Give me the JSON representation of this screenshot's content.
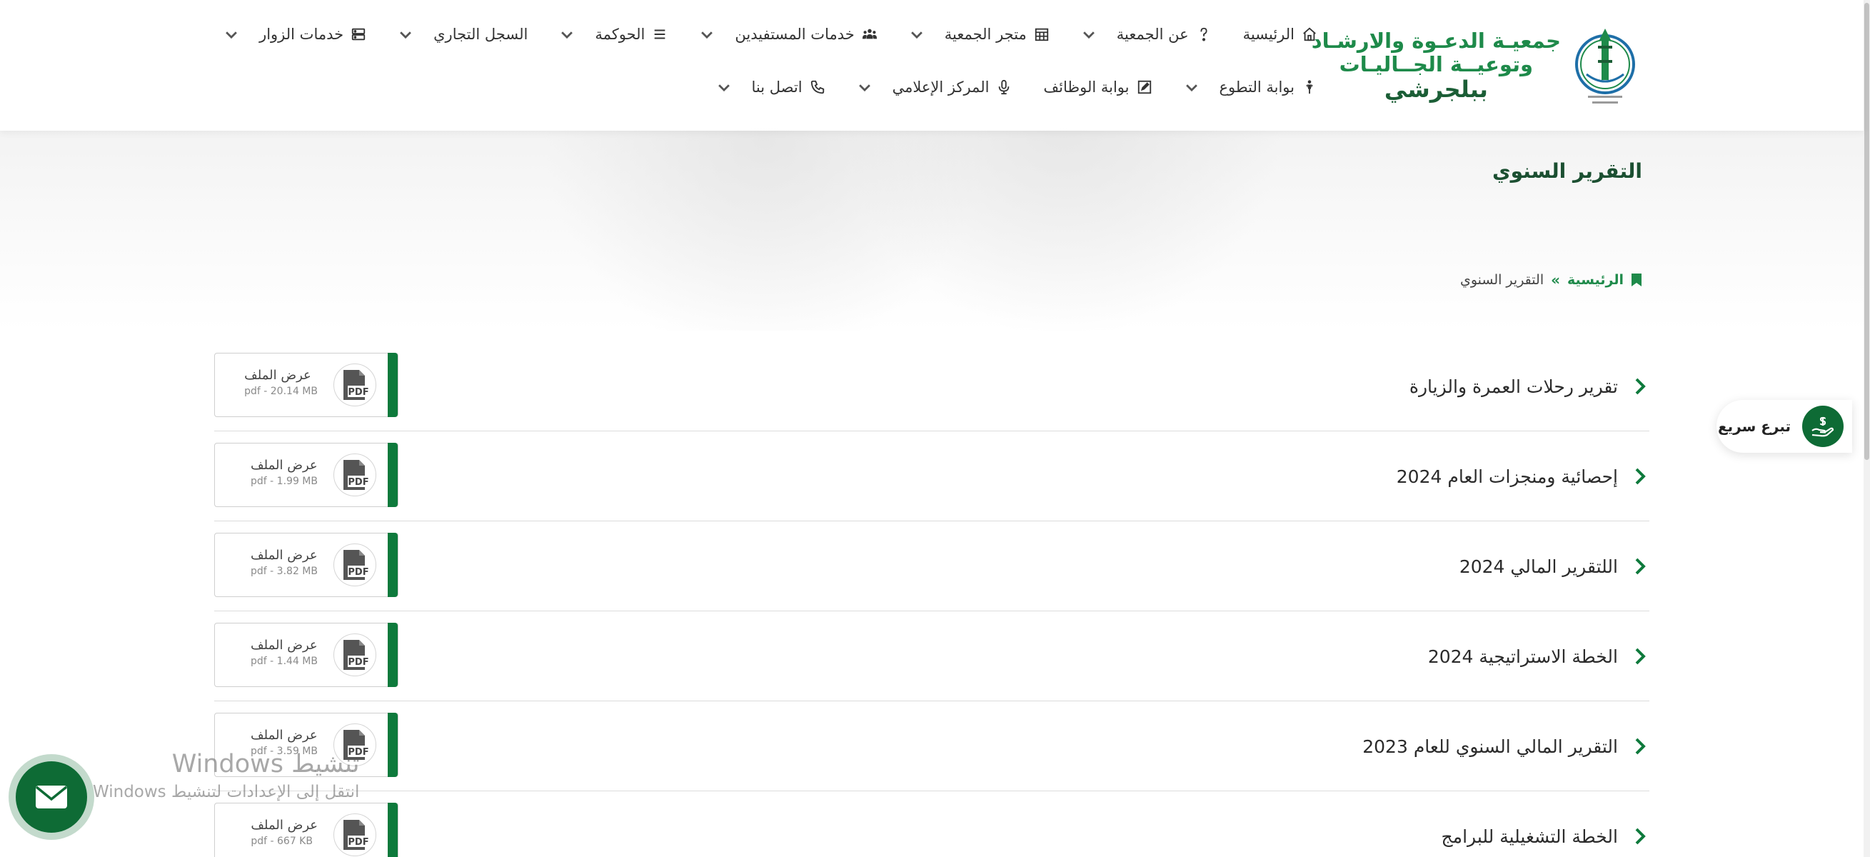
{
  "logo": {
    "line1": "جمعيـة الدعـوة والارشـاد",
    "line2": "وتوعيــة الجــاليـات",
    "line3": "ببلجرشي"
  },
  "nav": {
    "row1": [
      {
        "label": "الرئيسية",
        "icon": "home-icon",
        "dropdown": false
      },
      {
        "label": "عن الجمعية",
        "icon": "question-icon",
        "dropdown": true
      },
      {
        "label": "متجر الجمعية",
        "icon": "calendar-icon",
        "dropdown": true
      },
      {
        "label": "خدمات المستفيدين",
        "icon": "users-icon",
        "dropdown": true
      },
      {
        "label": "الحوكمة",
        "icon": "list-icon",
        "dropdown": true
      },
      {
        "label": "السجل التجاري",
        "icon": "",
        "dropdown": true
      },
      {
        "label": "خدمات الزوار",
        "icon": "server-icon",
        "dropdown": true
      }
    ],
    "row2": [
      {
        "label": "بوابة التطوع",
        "icon": "volunteer-icon",
        "dropdown": true
      },
      {
        "label": "بوابة الوظائف",
        "icon": "edit-icon",
        "dropdown": false
      },
      {
        "label": "المركز الإعلامي",
        "icon": "microphone-icon",
        "dropdown": true
      },
      {
        "label": "اتصل بنا",
        "icon": "phone-icon",
        "dropdown": true
      }
    ]
  },
  "page": {
    "title": "التقرير السنوي",
    "breadcrumb_home": "الرئيسية",
    "breadcrumb_sep": "»",
    "breadcrumb_current": "التقرير السنوي"
  },
  "files": [
    {
      "title": "تقرير رحلات العمرة والزيارة",
      "view_label": "عرض الملف",
      "size": "pdf - 20.14 MB"
    },
    {
      "title": "إحصائية ومنجزات العام 2024",
      "view_label": "عرض الملف",
      "size": "pdf - 1.99 MB"
    },
    {
      "title": "اللتقرير المالي 2024",
      "view_label": "عرض الملف",
      "size": "pdf - 3.82 MB"
    },
    {
      "title": "الخطة الاستراتيجية 2024",
      "view_label": "عرض الملف",
      "size": "pdf - 1.44 MB"
    },
    {
      "title": "التقرير المالي السنوي للعام 2023",
      "view_label": "عرض الملف",
      "size": "pdf - 3.59 MB"
    },
    {
      "title": "الخطة التشغيلية للبرامج",
      "view_label": "عرض الملف",
      "size": "pdf - 667 KB"
    }
  ],
  "pdf_badge": "PDF",
  "quick_donate": {
    "label": "تبرع سريع"
  },
  "watermark": {
    "title": "تنشيط Windows",
    "subtitle": "انتقل إلى الإعدادات لتنشيط Windows"
  },
  "colors": {
    "brand_green": "#1e8a4a",
    "dark_green": "#0e6b35",
    "bar_green": "#0e7a3c"
  }
}
